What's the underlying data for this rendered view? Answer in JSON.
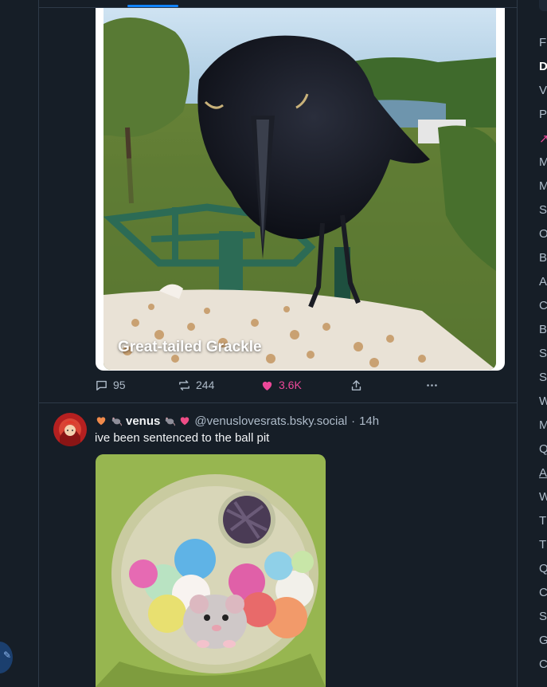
{
  "feed": {
    "post1": {
      "caption": "Great-tailed Grackle",
      "actions": {
        "replies": "95",
        "reposts": "244",
        "likes": "3.6K"
      }
    },
    "post2": {
      "display_name": "venus",
      "handle": "@venuslovesrats.bsky.social",
      "separator": "·",
      "time": "14h",
      "text": "ive been sentenced to the ball pit"
    }
  },
  "right_panel": {
    "items": [
      "F",
      "D",
      "V",
      "P",
      "",
      "M",
      "M",
      "S",
      "O",
      "B",
      "A",
      "C",
      "B",
      "S",
      "S",
      "W",
      "M",
      "Q",
      "A",
      "W",
      "T",
      "T",
      "Q",
      "C",
      "S",
      "G",
      "C"
    ]
  },
  "colors": {
    "background": "#161e27",
    "border": "#2e3a48",
    "accent": "#1083fe",
    "like": "#ec4899",
    "muted": "#aebbc9"
  },
  "icons": [
    "reply-icon",
    "repost-icon",
    "heart-icon",
    "share-icon",
    "more-icon",
    "orange-heart-emoji",
    "rat-emoji",
    "pink-heart-emoji"
  ]
}
